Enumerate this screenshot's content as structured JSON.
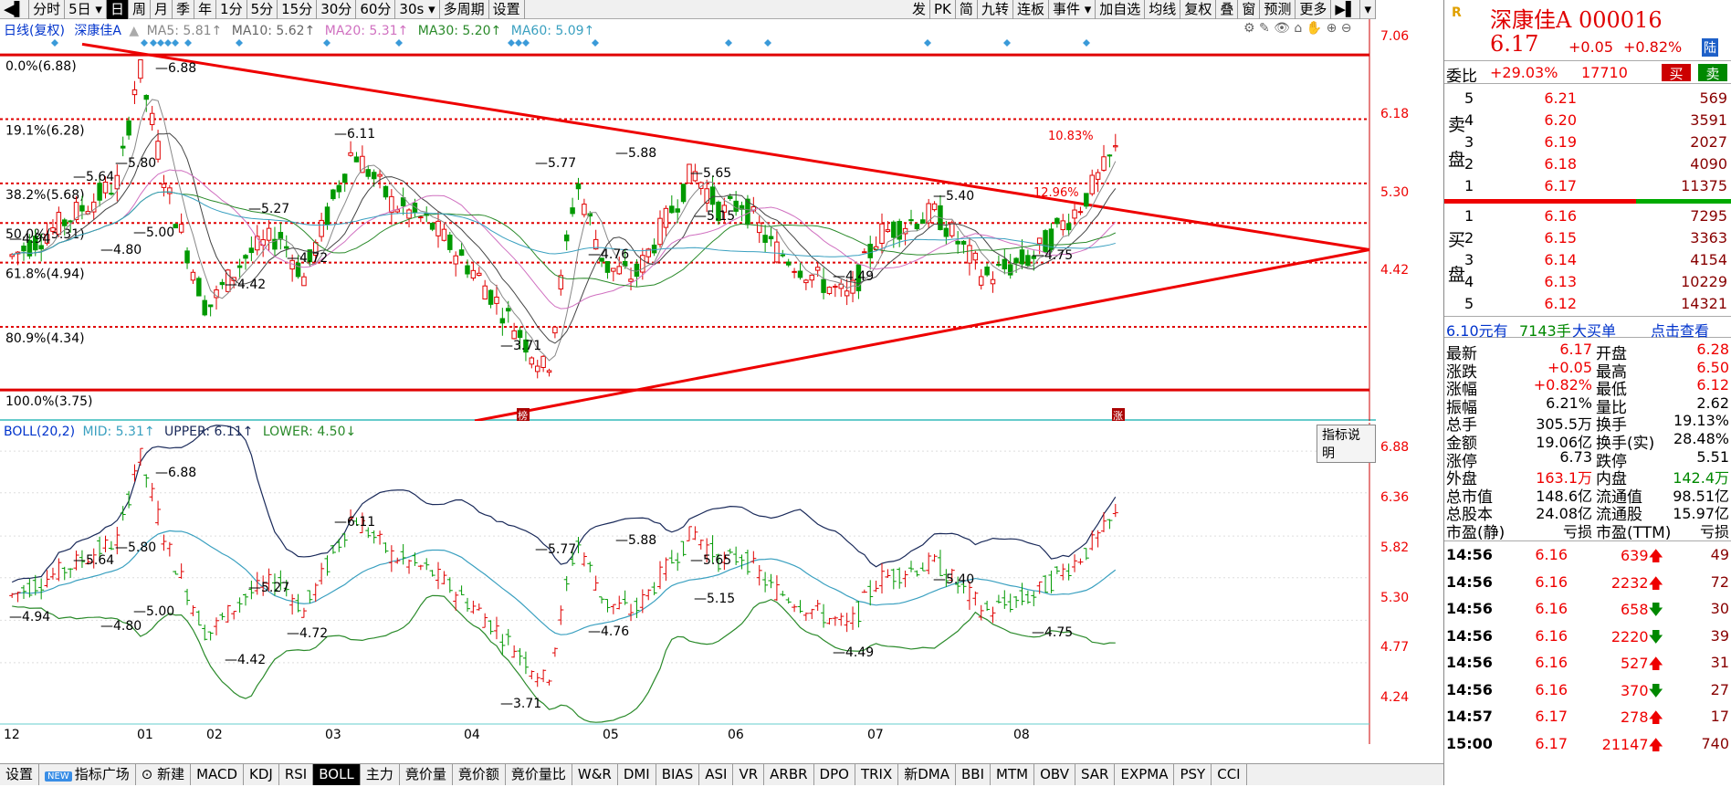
{
  "toolbar": {
    "left_items": [
      "分时",
      "5日",
      "日",
      "周",
      "月",
      "季",
      "年",
      "1分",
      "5分",
      "15分",
      "30分",
      "60分",
      "30s",
      "多周期",
      "设置"
    ],
    "right_items": [
      "发",
      "PK",
      "简",
      "九转",
      "连板",
      "事件",
      "加自选",
      "均线",
      "复权",
      "叠",
      "窗",
      "预测",
      "更多"
    ]
  },
  "main_chart": {
    "legend": {
      "name": "日线(复权)",
      "stock": "深康佳A",
      "ma5": "MA5: 5.81↑",
      "ma10": "MA10: 5.62↑",
      "ma20": "MA20: 5.31↑",
      "ma30": "MA30: 5.20↑",
      "ma60": "MA60: 5.09↑"
    },
    "fib_labels": [
      "0.0%(6.88)",
      "19.1%(6.28)",
      "38.2%(5.68)",
      "50.0%(5.31)",
      "61.8%(4.94)",
      "80.9%(4.34)",
      "100.0%(3.75)"
    ],
    "y_axis": [
      "7.06",
      "6.18",
      "5.30",
      "4.42"
    ],
    "annotations": [
      "6.88",
      "6.11",
      "5.80",
      "5.64",
      "5.27",
      "5.00",
      "4.94",
      "4.80",
      "4.72",
      "4.42",
      "5.77",
      "5.88",
      "5.65",
      "5.15",
      "4.76",
      "5.40",
      "4.75",
      "4.49",
      "3.71",
      "10.83%",
      "12.96%"
    ],
    "markers": [
      "榜",
      "涨"
    ]
  },
  "indicator": {
    "legend": {
      "name": "BOLL(20,2)",
      "mid": "MID: 5.31↑",
      "upper": "UPPER: 6.11↑",
      "lower": "LOWER: 4.50↓"
    },
    "help": "指标说明",
    "y_axis": [
      "6.88",
      "6.36",
      "5.82",
      "5.30",
      "4.77",
      "4.24"
    ],
    "x_axis": [
      "12",
      "01",
      "02",
      "03",
      "04",
      "05",
      "06",
      "07",
      "08"
    ]
  },
  "bottom_tabs": [
    "设置",
    "指标广场",
    "新建",
    "MACD",
    "KDJ",
    "RSI",
    "BOLL",
    "主力",
    "竟价量",
    "竟价额",
    "竟价量比",
    "W&R",
    "DMI",
    "BIAS",
    "ASI",
    "VR",
    "ARBR",
    "DPO",
    "TRIX",
    "新DMA",
    "BBI",
    "MTM",
    "OBV",
    "SAR",
    "EXPMA",
    "PSY",
    "CCI"
  ],
  "bottom_new_badge": "NEW",
  "quote": {
    "logo": "R",
    "name": "深康佳A",
    "code": "000016",
    "price": "6.17",
    "change": "+0.05",
    "pct": "+0.82%",
    "market": "陆",
    "wb_label": "委比",
    "wb_value": "+29.03%",
    "wb_qty": "17710",
    "buy_btn": "买",
    "sell_btn": "卖",
    "sell_side_label": [
      "卖",
      "盘"
    ],
    "buy_side_label": [
      "买",
      "盘"
    ],
    "asks": [
      {
        "lvl": "5",
        "price": "6.21",
        "vol": "569"
      },
      {
        "lvl": "4",
        "price": "6.20",
        "vol": "3591"
      },
      {
        "lvl": "3",
        "price": "6.19",
        "vol": "2027"
      },
      {
        "lvl": "2",
        "price": "6.18",
        "vol": "4090"
      },
      {
        "lvl": "1",
        "price": "6.17",
        "vol": "11375"
      }
    ],
    "bids": [
      {
        "lvl": "1",
        "price": "6.16",
        "vol": "7295"
      },
      {
        "lvl": "2",
        "price": "6.15",
        "vol": "3363"
      },
      {
        "lvl": "3",
        "price": "6.14",
        "vol": "4154"
      },
      {
        "lvl": "4",
        "price": "6.13",
        "vol": "10229"
      },
      {
        "lvl": "5",
        "price": "6.12",
        "vol": "14321"
      }
    ],
    "big_order": {
      "price": "6.10元有",
      "qty": "7143手",
      "label": "大买单",
      "link": "点击查看"
    },
    "stats": [
      {
        "k1": "最新",
        "v1": "6.17",
        "k2": "开盘",
        "v2": "6.28"
      },
      {
        "k1": "涨跌",
        "v1": "+0.05",
        "k2": "最高",
        "v2": "6.50"
      },
      {
        "k1": "涨幅",
        "v1": "+0.82%",
        "k2": "最低",
        "v2": "6.12"
      },
      {
        "k1": "振幅",
        "v1": "6.21%",
        "k2": "量比",
        "v2": "2.62"
      },
      {
        "k1": "总手",
        "v1": "305.5万",
        "k2": "换手",
        "v2": "19.13%"
      },
      {
        "k1": "金额",
        "v1": "19.06亿",
        "k2": "换手(实)",
        "v2": "28.48%"
      },
      {
        "k1": "涨停",
        "v1": "6.73",
        "k2": "跌停",
        "v2": "5.51"
      },
      {
        "k1": "外盘",
        "v1": "163.1万",
        "k2": "内盘",
        "v2": "142.4万"
      },
      {
        "k1": "总市值",
        "v1": "148.6亿",
        "k2": "流通值",
        "v2": "98.51亿"
      },
      {
        "k1": "总股本",
        "v1": "24.08亿",
        "k2": "流通股",
        "v2": "15.97亿"
      },
      {
        "k1": "市盈(静)",
        "v1": "亏损",
        "k2": "市盈(TTM)",
        "v2": "亏损"
      }
    ],
    "ticks": [
      {
        "time": "14:56",
        "price": "6.16",
        "vol": "639",
        "dir": "up",
        "n": "49"
      },
      {
        "time": "14:56",
        "price": "6.16",
        "vol": "2232",
        "dir": "up",
        "n": "72"
      },
      {
        "time": "14:56",
        "price": "6.16",
        "vol": "658",
        "dir": "down",
        "n": "30"
      },
      {
        "time": "14:56",
        "price": "6.16",
        "vol": "2220",
        "dir": "down",
        "n": "39"
      },
      {
        "time": "14:56",
        "price": "6.16",
        "vol": "527",
        "dir": "up",
        "n": "31"
      },
      {
        "time": "14:56",
        "price": "6.16",
        "vol": "370",
        "dir": "down",
        "n": "27"
      },
      {
        "time": "14:57",
        "price": "6.17",
        "vol": "278",
        "dir": "up",
        "n": "17"
      },
      {
        "time": "15:00",
        "price": "6.17",
        "vol": "21147",
        "dir": "up",
        "n": "740"
      }
    ]
  },
  "colors": {
    "up": "#e00000",
    "down": "#009900",
    "fib": "#e00000",
    "boll_upper": "#1a2a5a",
    "boll_mid": "#3aa0c0",
    "boll_lower": "#2a8a2a"
  }
}
